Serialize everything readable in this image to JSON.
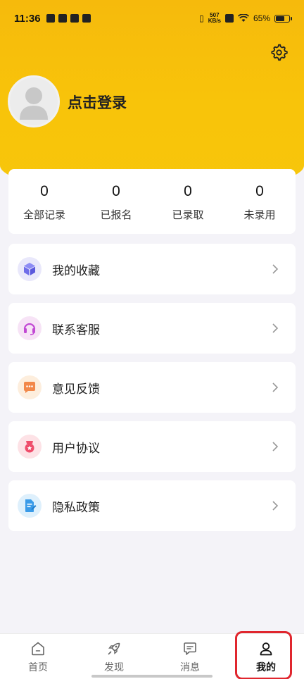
{
  "status_bar": {
    "time": "11:36",
    "net_speed_value": "507",
    "net_speed_unit": "KB/s",
    "battery": "65%"
  },
  "profile": {
    "login_label": "点击登录"
  },
  "stats": [
    {
      "value": "0",
      "label": "全部记录"
    },
    {
      "value": "0",
      "label": "已报名"
    },
    {
      "value": "0",
      "label": "已录取"
    },
    {
      "value": "0",
      "label": "未录用"
    }
  ],
  "menu": [
    {
      "label": "我的收藏",
      "icon": "cube-icon"
    },
    {
      "label": "联系客服",
      "icon": "headset-icon"
    },
    {
      "label": "意见反馈",
      "icon": "chat-bubble-icon"
    },
    {
      "label": "用户协议",
      "icon": "badge-icon"
    },
    {
      "label": "隐私政策",
      "icon": "document-icon"
    }
  ],
  "tabs": [
    {
      "label": "首页",
      "icon": "home-icon"
    },
    {
      "label": "发现",
      "icon": "rocket-icon"
    },
    {
      "label": "消息",
      "icon": "message-icon"
    },
    {
      "label": "我的",
      "icon": "user-icon",
      "active": true
    }
  ],
  "colors": {
    "header_yellow": "#f7c20b",
    "highlight_red": "#e0262e"
  }
}
